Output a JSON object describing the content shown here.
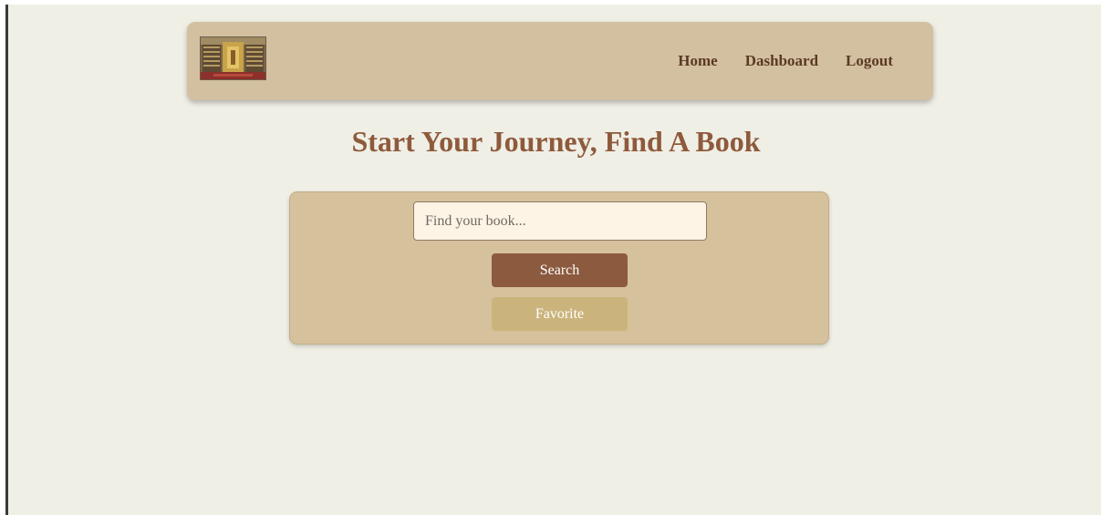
{
  "header": {
    "logo_alt": "library logo",
    "nav": [
      {
        "label": "Home"
      },
      {
        "label": "Dashboard"
      },
      {
        "label": "Logout"
      }
    ]
  },
  "main": {
    "title": "Start Your Journey, Find A Book",
    "search": {
      "placeholder": "Find your book...",
      "value": ""
    },
    "search_button": "Search",
    "favorite_button": "Favorite"
  },
  "colors": {
    "page_background": "#f0efe6",
    "navbar_background": "#d3c0a1",
    "panel_background": "#d6c19d",
    "title_color": "#8e5a3c",
    "nav_link_color": "#5b3a24",
    "search_button": "#8c5a3e",
    "favorite_button": "#cbb47c",
    "input_background": "#fdf4e6"
  }
}
